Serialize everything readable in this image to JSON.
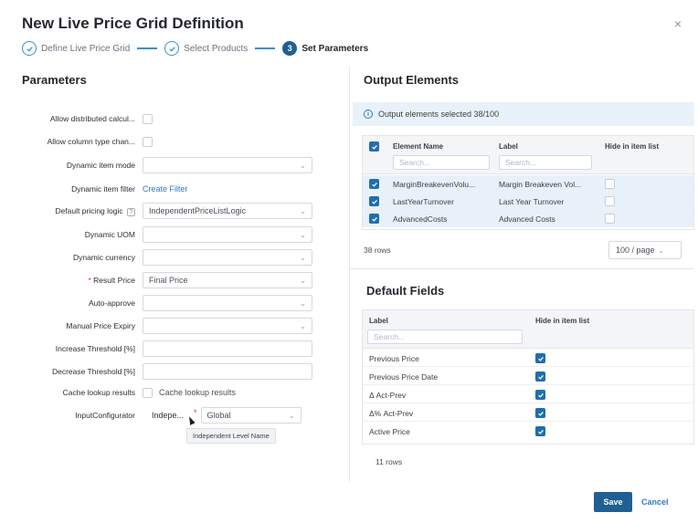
{
  "dialog": {
    "title": "New Live Price Grid Definition",
    "close_glyph": "×"
  },
  "steps": [
    {
      "label": "Define Live Price Grid",
      "state": "done"
    },
    {
      "label": "Select Products",
      "state": "done"
    },
    {
      "number": "3",
      "label": "Set Parameters",
      "state": "active"
    }
  ],
  "parameters": {
    "title": "Parameters",
    "fields": [
      {
        "label": "Allow distributed calcul...",
        "type": "checkbox"
      },
      {
        "label": "Allow column type chan...",
        "type": "checkbox"
      },
      {
        "label": "Dynamic item mode",
        "type": "select",
        "value": ""
      },
      {
        "label": "Dynamic item filter",
        "type": "link",
        "value": "Create Filter"
      },
      {
        "label": "Default pricing logic",
        "type": "select",
        "value": "IndependentPriceListLogic",
        "help": "?"
      },
      {
        "label": "Dynamic UOM",
        "type": "select",
        "value": ""
      },
      {
        "label": "Dynamic currency",
        "type": "select",
        "value": ""
      },
      {
        "label": "Result Price",
        "type": "select",
        "value": "Final Price",
        "required": "*"
      },
      {
        "label": "Auto-approve",
        "type": "select",
        "value": ""
      },
      {
        "label": "Manual Price Expiry",
        "type": "select",
        "value": ""
      },
      {
        "label": "Increase Threshold [%]",
        "type": "input",
        "value": ""
      },
      {
        "label": "Decrease Threshold [%]",
        "type": "input",
        "value": ""
      },
      {
        "label": "Cache lookup results",
        "type": "checkbox",
        "checkbox_label": "Cache lookup results"
      },
      {
        "label": "InputConfigurator",
        "type": "configurator",
        "short_label": "Indepe...",
        "required": "*",
        "value": "Global"
      }
    ],
    "tooltip": "Independent Level Name"
  },
  "output_elements": {
    "title": "Output Elements",
    "info": "Output elements selected 38/100",
    "columns": [
      "Element Name",
      "Label",
      "Hide in item list"
    ],
    "search_placeholder": "Search...",
    "rows": [
      {
        "name": "MarginBreakevenVolu...",
        "label": "Margin Breakeven Vol..."
      },
      {
        "name": "LastYearTurnover",
        "label": "Last Year Turnover"
      },
      {
        "name": "AdvancedCosts",
        "label": "Advanced Costs"
      }
    ],
    "rows_count": "38 rows",
    "page_size": "100 / page"
  },
  "default_fields": {
    "title": "Default Fields",
    "columns": [
      "Label",
      "Hide in item list"
    ],
    "search_placeholder": "Search...",
    "rows": [
      {
        "label": "Previous Price"
      },
      {
        "label": "Previous Price Date"
      },
      {
        "label": "Δ Act-Prev"
      },
      {
        "label": "Δ% Act-Prev"
      },
      {
        "label": "Active Price"
      }
    ],
    "rows_count": "11 rows"
  },
  "footer": {
    "save": "Save",
    "cancel": "Cancel"
  },
  "colors": {
    "primary": "#1f5f93",
    "link": "#2f7cc0",
    "info_bg": "#e9f2fa"
  }
}
